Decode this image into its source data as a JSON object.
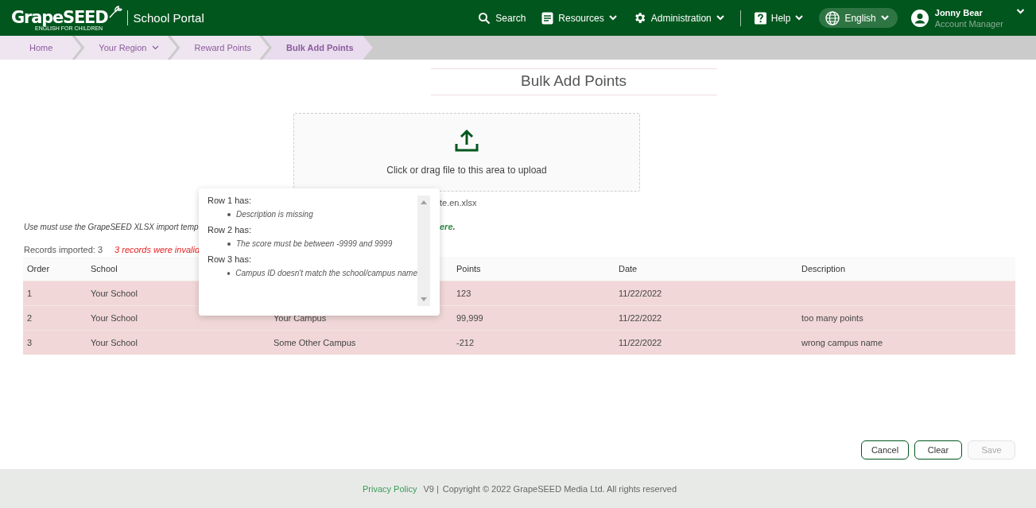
{
  "header": {
    "logo": "GrapeSEED",
    "logo_tagline": "ENGLISH FOR CHILDREN",
    "portal_title": "School Portal",
    "nav": [
      {
        "label": "Search",
        "kind": "search",
        "dropdown": false
      },
      {
        "label": "Resources",
        "kind": "document",
        "dropdown": true
      },
      {
        "label": "Administration",
        "kind": "gear",
        "dropdown": true
      },
      {
        "label": "Help",
        "kind": "help",
        "dropdown": true
      }
    ],
    "language": {
      "label": "English"
    },
    "user": {
      "name": "Jonny Bear",
      "role": "Account Manager"
    }
  },
  "breadcrumb": [
    {
      "label": "Home",
      "dropdown": false,
      "selected": false
    },
    {
      "label": "Your Region",
      "dropdown": true,
      "selected": false
    },
    {
      "label": "Reward Points",
      "dropdown": false,
      "selected": false
    },
    {
      "label": "Bulk Add Points",
      "dropdown": false,
      "selected": true
    }
  ],
  "page_title": "Bulk Add Points",
  "upload": {
    "text": "Click or drag file to this area to upload"
  },
  "file_name_fragment": "te.en.xlsx",
  "instruction_start": "Use must use the GrapeSEED XLSX import temp",
  "instruction_end_link": "ere",
  "instruction_end": ".",
  "records_imported": "Records imported: 3",
  "invalid_message": "3 records were invalid",
  "table": {
    "columns": [
      "Order",
      "School",
      "",
      "Points",
      "Date",
      "Description"
    ],
    "rows": [
      {
        "cells": [
          "1",
          "Your School",
          "",
          "123",
          "11/22/2022",
          ""
        ],
        "invalid": true
      },
      {
        "cells": [
          "2",
          "Your School",
          "Your Campus",
          "99,999",
          "11/22/2022",
          "too many points"
        ],
        "invalid": true
      },
      {
        "cells": [
          "3",
          "Your School",
          "Some Other Campus",
          "-212",
          "11/22/2022",
          "wrong campus name"
        ],
        "invalid": true
      }
    ]
  },
  "popover": {
    "groups": [
      {
        "title": "Row 1 has:",
        "errors": [
          "Description is missing"
        ]
      },
      {
        "title": "Row 2 has:",
        "errors": [
          "The score must be between -9999 and 9999"
        ]
      },
      {
        "title": "Row 3 has:",
        "errors": [
          "Campus ID doesn't match the school/campus name"
        ]
      }
    ]
  },
  "buttons": [
    {
      "label": "Cancel",
      "disabled": false
    },
    {
      "label": "Clear",
      "disabled": false
    },
    {
      "label": "Save",
      "disabled": true
    }
  ],
  "footer": {
    "link": "Privacy Policy",
    "version": "V9 |",
    "copyright": "Copyright © 2022 GrapeSEED Media Ltd. All rights reserved"
  }
}
